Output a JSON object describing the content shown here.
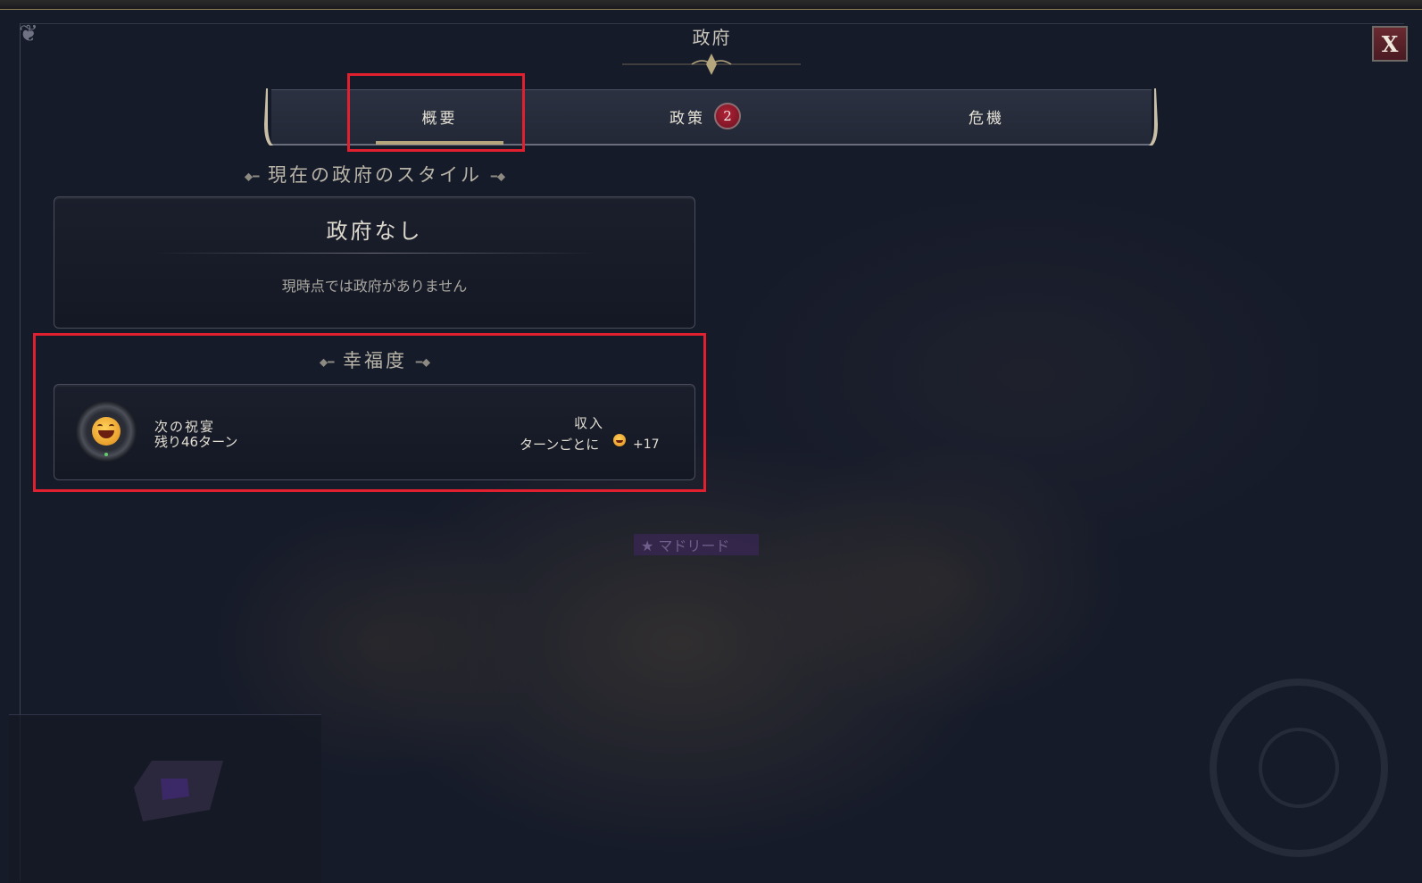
{
  "window": {
    "title": "政府",
    "close_label": "X"
  },
  "tabs": [
    {
      "label": "概要",
      "active": true
    },
    {
      "label": "政策",
      "badge": "2"
    },
    {
      "label": "危機"
    }
  ],
  "government_style": {
    "header": "現在の政府のスタイル",
    "name": "政府なし",
    "description": "現時点では政府がありません"
  },
  "happiness": {
    "header": "幸福度",
    "next_festival_label": "次の祝宴",
    "turns_remaining": "残り46ターン",
    "income_label": "収入",
    "per_turn_label": "ターンごとに",
    "per_turn_value": "+17"
  },
  "colors": {
    "accent_gold": "#b5a67e",
    "badge_red": "#b02236",
    "highlight_red": "#e0202e",
    "background": "#151a29"
  }
}
